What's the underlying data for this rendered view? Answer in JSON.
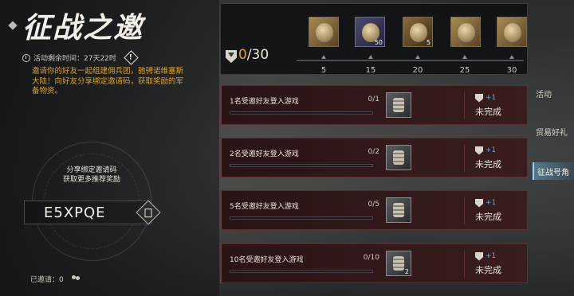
{
  "title": "征战之邀",
  "timer": {
    "label": "活动剩余时间：27天22时"
  },
  "description": "邀请你的好友一起组建佣兵团，驰骋诺维塞斯大陆！向好友分享绑定邀请码，获取奖励的军备物资。",
  "share": {
    "line1": "分享绑定邀请码",
    "line2": "获取更多推荐奖励"
  },
  "invite_code": "E5XPQE",
  "invited": {
    "label": "已邀请：0"
  },
  "progress": {
    "current": "0",
    "total": "/30"
  },
  "milestones": [
    {
      "threshold": "5",
      "icon": "character-portrait-icon",
      "qty": ""
    },
    {
      "threshold": "15",
      "icon": "supply-canister-icon",
      "qty": "50"
    },
    {
      "threshold": "20",
      "icon": "gold-coin-icon",
      "qty": "5"
    },
    {
      "threshold": "25",
      "icon": "emblem-icon",
      "qty": ""
    },
    {
      "threshold": "30",
      "icon": "warrior-portrait-icon",
      "qty": ""
    }
  ],
  "tasks": [
    {
      "name": "1名受邀好友登入游戏",
      "count": "0/1",
      "item_qty": "",
      "reward": "+1",
      "status": "未完成"
    },
    {
      "name": "2名受邀好友登入游戏",
      "count": "0/2",
      "item_qty": "",
      "reward": "+1",
      "status": "未完成"
    },
    {
      "name": "5名受邀好友登入游戏",
      "count": "0/5",
      "item_qty": "",
      "reward": "+1",
      "status": "未完成"
    },
    {
      "name": "10名受邀好友登入游戏",
      "count": "0/10",
      "item_qty": "2",
      "reward": "+1",
      "status": "未完成"
    }
  ],
  "side_tabs": [
    {
      "label": "活动",
      "active": false
    },
    {
      "label": "贸易好礼",
      "active": false
    },
    {
      "label": "征战号角",
      "active": true
    }
  ],
  "colors": {
    "accent": "#e0a524",
    "task_bg": "#3a1d1e",
    "active_tab": "#5a8caa"
  }
}
